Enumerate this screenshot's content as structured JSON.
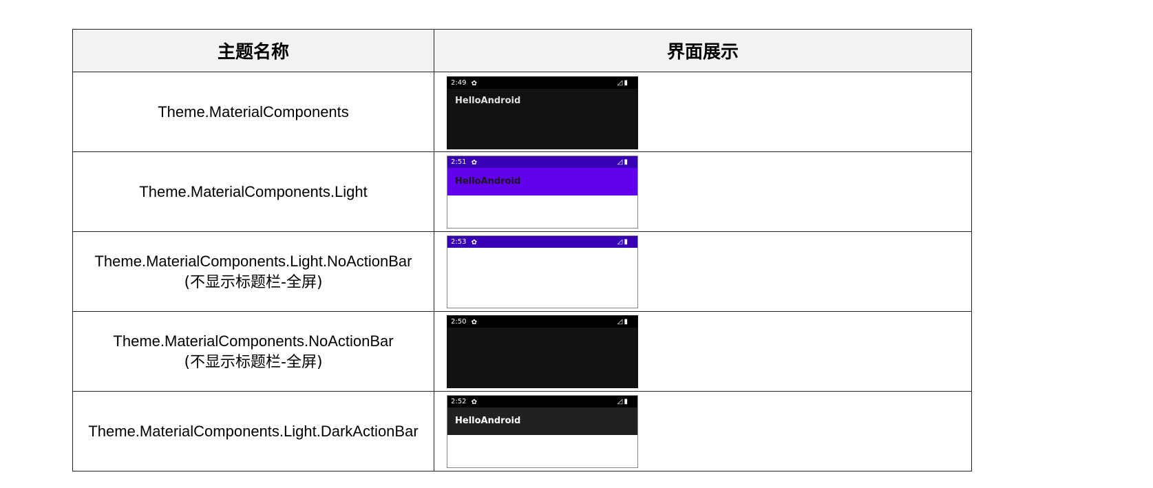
{
  "table": {
    "headers": [
      "主题名称",
      "界面展示"
    ],
    "rows": [
      {
        "name": "Theme.MaterialComponents",
        "note": "",
        "preview": {
          "time": "2:49",
          "status_bar_color": "#000000",
          "app_bar_color": "#121212",
          "app_bar_title": "HelloAndroid",
          "app_bar_text_color": "#e0e0e0",
          "body_color": "#121212",
          "gear_icon": "gear-icon",
          "signal_icon": "signal-icon",
          "battery_icon": "battery-icon"
        }
      },
      {
        "name": "Theme.MaterialComponents.Light",
        "note": "",
        "preview": {
          "time": "2:51",
          "status_bar_color": "#3700B3",
          "app_bar_color": "#6200EE",
          "app_bar_title": "HelloAndroid",
          "app_bar_text_color": "#1a1a1a",
          "body_color": "#ffffff",
          "gear_icon": "gear-icon",
          "signal_icon": "signal-icon",
          "battery_icon": "battery-icon"
        }
      },
      {
        "name": "Theme.MaterialComponents.Light.NoActionBar",
        "note": "(不显示标题栏-全屏)",
        "preview": {
          "time": "2:53",
          "status_bar_color": "#3700B3",
          "app_bar_color": "",
          "app_bar_title": "",
          "body_color": "#ffffff",
          "gear_icon": "gear-icon",
          "signal_icon": "signal-icon",
          "battery_icon": "battery-icon"
        }
      },
      {
        "name": "Theme.MaterialComponents.NoActionBar",
        "note": "(不显示标题栏-全屏)",
        "preview": {
          "time": "2:50",
          "status_bar_color": "#000000",
          "app_bar_color": "",
          "app_bar_title": "",
          "body_color": "#121212",
          "gear_icon": "gear-icon",
          "signal_icon": "signal-icon",
          "battery_icon": "battery-icon"
        }
      },
      {
        "name": "Theme.MaterialComponents.Light.DarkActionBar",
        "note": "",
        "preview": {
          "time": "2:52",
          "status_bar_color": "#000000",
          "app_bar_color": "#212121",
          "app_bar_title": "HelloAndroid",
          "app_bar_text_color": "#ffffff",
          "body_color": "#ffffff",
          "gear_icon": "gear-icon",
          "signal_icon": "signal-icon",
          "battery_icon": "battery-icon"
        }
      }
    ]
  }
}
